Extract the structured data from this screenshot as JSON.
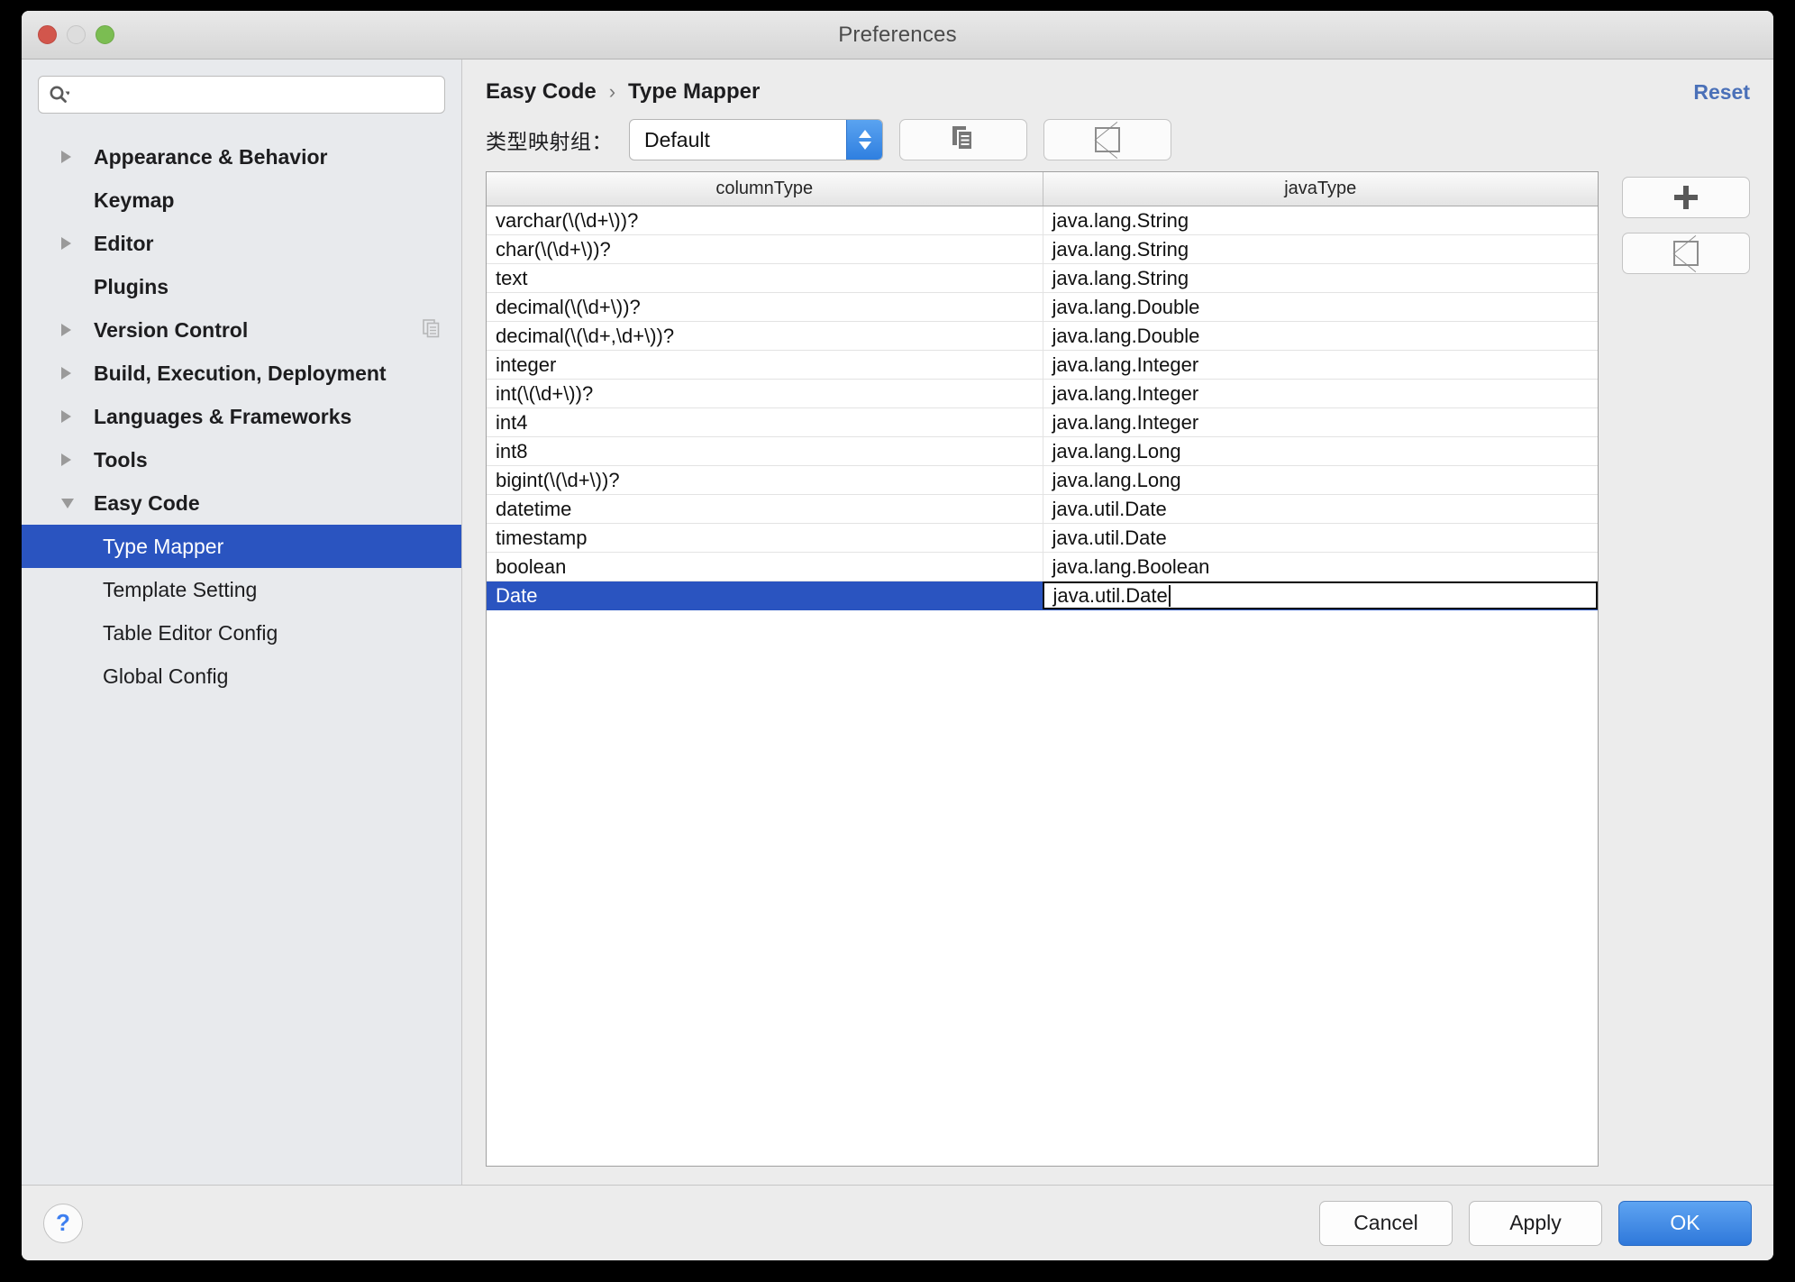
{
  "window": {
    "title": "Preferences",
    "traffic_lights": [
      "close-button",
      "minimize-button",
      "zoom-button"
    ]
  },
  "search": {
    "value": "",
    "placeholder": ""
  },
  "sidebar": {
    "items": [
      {
        "label": "Appearance & Behavior",
        "level": "top",
        "expandable": true,
        "expanded": false
      },
      {
        "label": "Keymap",
        "level": "top",
        "expandable": false,
        "expanded": false
      },
      {
        "label": "Editor",
        "level": "top",
        "expandable": true,
        "expanded": false
      },
      {
        "label": "Plugins",
        "level": "top",
        "expandable": false,
        "expanded": false
      },
      {
        "label": "Version Control",
        "level": "top",
        "expandable": true,
        "expanded": false,
        "trailing_icon": "copy-icon"
      },
      {
        "label": "Build, Execution, Deployment",
        "level": "top",
        "expandable": true,
        "expanded": false
      },
      {
        "label": "Languages & Frameworks",
        "level": "top",
        "expandable": true,
        "expanded": false
      },
      {
        "label": "Tools",
        "level": "top",
        "expandable": true,
        "expanded": false
      },
      {
        "label": "Easy Code",
        "level": "top",
        "expandable": true,
        "expanded": true
      },
      {
        "label": "Type Mapper",
        "level": "child",
        "selected": true
      },
      {
        "label": "Template Setting",
        "level": "child",
        "selected": false
      },
      {
        "label": "Table Editor Config",
        "level": "child",
        "selected": false
      },
      {
        "label": "Global Config",
        "level": "child",
        "selected": false
      }
    ]
  },
  "main": {
    "breadcrumb": {
      "root": "Easy Code",
      "separator": "›",
      "current": "Type Mapper"
    },
    "reset_label": "Reset",
    "toolbar": {
      "mapper_label": "类型映射组：",
      "mapper_value": "Default",
      "copy_button_icon": "copy-icon",
      "delete_button_icon": "broken-image-icon"
    },
    "table": {
      "headers": [
        "columnType",
        "javaType"
      ],
      "rows": [
        {
          "columnType": "varchar(\\(\\d+\\))?",
          "javaType": "java.lang.String"
        },
        {
          "columnType": "char(\\(\\d+\\))?",
          "javaType": "java.lang.String"
        },
        {
          "columnType": "text",
          "javaType": "java.lang.String"
        },
        {
          "columnType": "decimal(\\(\\d+\\))?",
          "javaType": "java.lang.Double"
        },
        {
          "columnType": "decimal(\\(\\d+,\\d+\\))?",
          "javaType": "java.lang.Double"
        },
        {
          "columnType": "integer",
          "javaType": "java.lang.Integer"
        },
        {
          "columnType": "int(\\(\\d+\\))?",
          "javaType": "java.lang.Integer"
        },
        {
          "columnType": "int4",
          "javaType": "java.lang.Integer"
        },
        {
          "columnType": "int8",
          "javaType": "java.lang.Long"
        },
        {
          "columnType": "bigint(\\(\\d+\\))?",
          "javaType": "java.lang.Long"
        },
        {
          "columnType": "datetime",
          "javaType": "java.util.Date"
        },
        {
          "columnType": "timestamp",
          "javaType": "java.util.Date"
        },
        {
          "columnType": "boolean",
          "javaType": "java.lang.Boolean"
        },
        {
          "columnType": "Date",
          "javaType": "java.util.Date",
          "selected": true,
          "editing": true
        }
      ]
    },
    "side_buttons": [
      {
        "icon": "plus-icon",
        "name": "add-row-button"
      },
      {
        "icon": "broken-image-icon",
        "name": "remove-row-button"
      }
    ]
  },
  "footer": {
    "help_label": "?",
    "cancel_label": "Cancel",
    "apply_label": "Apply",
    "ok_label": "OK"
  },
  "colors": {
    "selection_blue": "#2a54c0",
    "primary_button_blue": "#2f78da",
    "reset_link_blue": "#4a70b8",
    "help_blue": "#3d7ff0"
  }
}
